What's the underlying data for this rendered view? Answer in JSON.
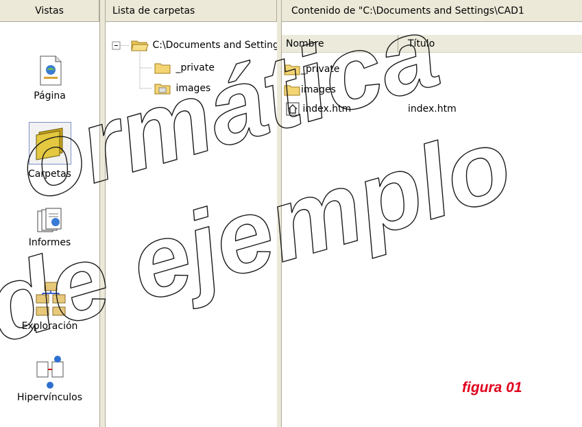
{
  "views": {
    "header": "Vistas",
    "items": [
      {
        "label": "Página",
        "icon": "page-icon"
      },
      {
        "label": "Carpetas",
        "icon": "folders-icon",
        "selected": true
      },
      {
        "label": "Informes",
        "icon": "reports-icon"
      },
      {
        "label": "Exploración",
        "icon": "navigation-icon"
      },
      {
        "label": "Hipervínculos",
        "icon": "hyperlinks-icon"
      }
    ]
  },
  "folder_list": {
    "header": "Lista de carpetas",
    "root": "C:\\Documents and Settings",
    "children": [
      "_private",
      "images"
    ]
  },
  "contents": {
    "header": "Contenido de \"C:\\Documents and Settings\\CAD1",
    "columns": [
      "Nombre",
      "Título"
    ],
    "rows": [
      {
        "name": "_private",
        "title": "",
        "icon": "folder-icon"
      },
      {
        "name": "images",
        "title": "",
        "icon": "folder-icon"
      },
      {
        "name": "index.htm",
        "title": "index.htm",
        "icon": "home-page-icon"
      }
    ]
  },
  "watermark": {
    "line1": "ormática",
    "line2": "de ejemplo"
  },
  "caption": "figura 01",
  "colors": {
    "chrome": "#ece9d8",
    "caption": "#e0001b",
    "folder": "#f3d574"
  }
}
